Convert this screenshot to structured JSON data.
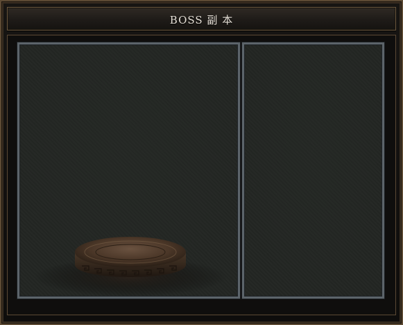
{
  "window": {
    "title": "BOSS 副 本"
  },
  "panels": {
    "left": {
      "content": "boss-pedestal"
    },
    "right": {
      "content": "empty"
    }
  },
  "colors": {
    "frame_gold": "#5d4a34",
    "panel_border": "#5c646a",
    "panel_bg": "#232623",
    "title_text": "#e7e1d8"
  }
}
